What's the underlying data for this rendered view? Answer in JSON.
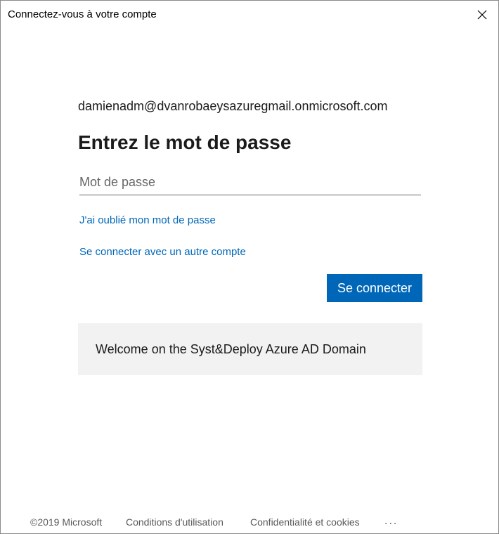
{
  "window": {
    "title": "Connectez-vous à votre compte",
    "close_icon": "close-icon"
  },
  "signin": {
    "account_email": "damienadm@dvanrobaeysazuregmail.onmicrosoft.com",
    "heading": "Entrez le mot de passe",
    "password_placeholder": "Mot de passe",
    "password_value": "",
    "forgot_password_link": "J'ai oublié mon mot de passe",
    "other_account_link": "Se connecter avec un autre compte",
    "signin_button": "Se connecter",
    "banner_text": "Welcome on the Syst&Deploy Azure AD Domain"
  },
  "footer": {
    "copyright": "©2019 Microsoft",
    "terms": "Conditions d'utilisation",
    "privacy": "Confidentialité et cookies",
    "more": "..."
  },
  "colors": {
    "accent": "#0067b8",
    "banner_background": "#f2f2f2",
    "text": "#1b1b1b"
  }
}
